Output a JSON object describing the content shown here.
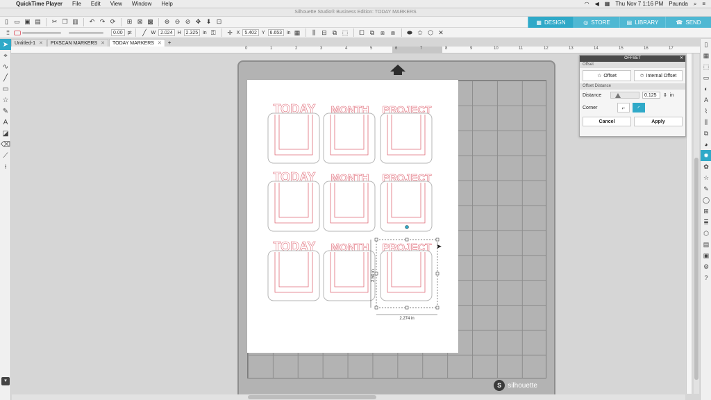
{
  "menubar": {
    "app": "QuickTime Player",
    "items": [
      "File",
      "Edit",
      "View",
      "Window",
      "Help"
    ],
    "clock": "Thu Nov 7  1:16 PM",
    "user": "Paunda"
  },
  "window": {
    "title": "Silhouette Studio® Business Edition: TODAY MARKERS"
  },
  "nav_tabs": [
    "DESIGN",
    "STORE",
    "LIBRARY",
    "SEND"
  ],
  "toolbar2": {
    "line_weight": "0.00",
    "line_unit": "pt",
    "w_label": "W",
    "w_value": "2.024",
    "h_label": "H",
    "h_value": "2.325",
    "size_unit": "in",
    "x_label": "X",
    "x_value": "5.402",
    "y_label": "Y",
    "y_value": "6.653",
    "pos_unit": "in"
  },
  "doc_tabs": [
    "Untitled-1",
    "PIXSCAN MARKERS",
    "TODAY MARKERS"
  ],
  "ruler_ticks": [
    "0",
    "1",
    "2",
    "3",
    "4",
    "5",
    "6",
    "7",
    "8",
    "9",
    "10",
    "11",
    "12",
    "13",
    "14",
    "15",
    "16",
    "17"
  ],
  "design": {
    "words": [
      "TODAY",
      "MONTH",
      "PROJECT"
    ],
    "dim_width": "2.274 in",
    "dim_height": "2.59 in"
  },
  "mat": {
    "brand": "silhouette"
  },
  "offset_panel": {
    "header": "OFFSET",
    "section1": "Offset",
    "btn_offset": "Offset",
    "btn_internal": "Internal Offset",
    "section2": "Offset Distance",
    "distance_label": "Distance",
    "distance_value": "0.125",
    "distance_unit": "in",
    "corner_label": "Corner",
    "cancel": "Cancel",
    "apply": "Apply"
  },
  "colors": {
    "accent": "#2fa9c8",
    "cut_line": "#e06b78",
    "mat": "#b3b3b3"
  }
}
